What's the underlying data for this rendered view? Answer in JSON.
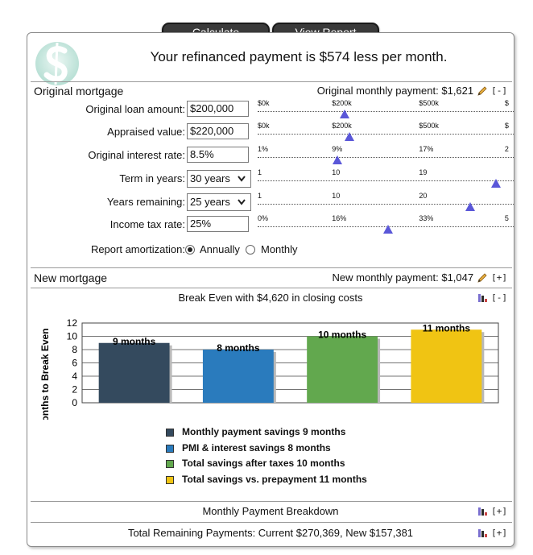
{
  "buttons": {
    "calculate": "Calculate",
    "view_report": "View Report"
  },
  "headline": "Your refinanced payment is $574 less per month.",
  "original": {
    "title": "Original mortgage",
    "summary": "Original monthly payment: $1,621",
    "toggle": "[-]",
    "fields": [
      {
        "label": "Original loan amount:",
        "value": "$200,000",
        "ticks": [
          "$0k",
          "$200k",
          "$500k",
          "$"
        ],
        "level": 0.34
      },
      {
        "label": "Appraised value:",
        "value": "$220,000",
        "ticks": [
          "$0k",
          "$200k",
          "$500k",
          "$"
        ],
        "level": 0.36
      },
      {
        "label": "Original interest rate:",
        "value": "8.5%",
        "ticks": [
          "1%",
          "9%",
          "17%",
          "2"
        ],
        "level": 0.31
      },
      {
        "label": "Term in years:",
        "value": "30 years",
        "ticks": [
          "1",
          "10",
          "19",
          ""
        ],
        "level": 0.93
      },
      {
        "label": "Years remaining:",
        "value": "25 years",
        "ticks": [
          "1",
          "10",
          "20",
          ""
        ],
        "level": 0.83
      },
      {
        "label": "Income tax rate:",
        "value": "25%",
        "ticks": [
          "0%",
          "16%",
          "33%",
          "5"
        ],
        "level": 0.51
      }
    ],
    "amortization": {
      "label": "Report amortization:",
      "options": [
        "Annually",
        "Monthly"
      ],
      "selected": "Annually"
    }
  },
  "new_mortgage": {
    "title": "New mortgage",
    "summary": "New monthly payment: $1,047",
    "toggle": "[+]"
  },
  "break_even": {
    "toggle": "[-]"
  },
  "chart_data": {
    "type": "bar",
    "title": "Break Even with $4,620 in closing costs",
    "ylabel": "Months to Break Even",
    "xlabel": "",
    "ylim": [
      0,
      12
    ],
    "yticks": [
      0,
      2,
      4,
      6,
      8,
      10,
      12
    ],
    "grid": true,
    "categories": [
      "Monthly payment savings",
      "PMI & interest savings",
      "Total savings after taxes",
      "Total savings vs. prepayment"
    ],
    "values": [
      9,
      8,
      10,
      11
    ],
    "data_labels": [
      "9 months",
      "8 months",
      "10 months",
      "11 months"
    ],
    "colors": [
      "#344a5e",
      "#2a7bbd",
      "#62a84e",
      "#f0c413"
    ],
    "legend": [
      "Monthly payment savings 9 months",
      "PMI & interest savings 8 months",
      "Total savings after taxes 10 months",
      "Total savings vs. prepayment 11 months"
    ]
  },
  "breakdown": {
    "title": "Monthly Payment Breakdown",
    "toggle": "[+]"
  },
  "remaining": {
    "title": "Total Remaining Payments: Current $270,369, New $157,381",
    "toggle": "[+]"
  }
}
